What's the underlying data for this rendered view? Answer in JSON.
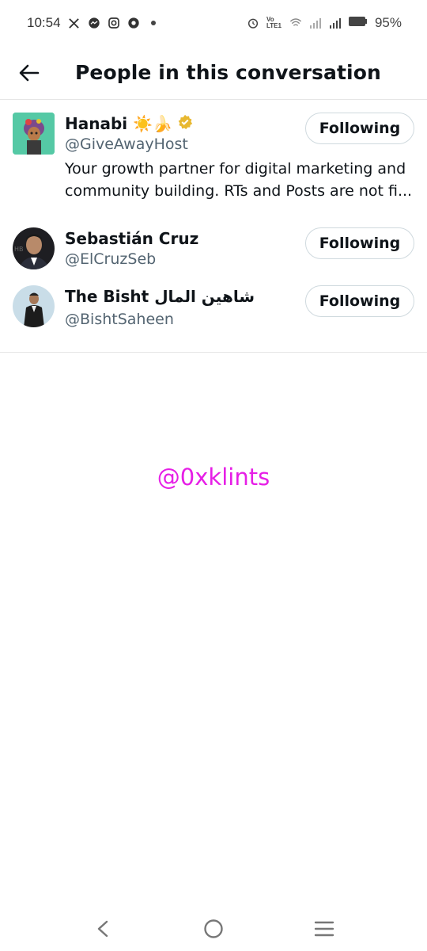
{
  "status_bar": {
    "time": "10:54",
    "battery": "95%",
    "left_icons": [
      "x-logo-icon",
      "messenger-icon",
      "instagram-icon",
      "shutter-icon",
      "dot-icon"
    ],
    "right_icons": [
      "alarm-icon",
      "volte-icon",
      "wifi-icon",
      "signal-icon",
      "signal-icon",
      "battery-icon"
    ],
    "volte_text": "Vo LTE1"
  },
  "header": {
    "title": "People in this conversation",
    "back_icon": "arrow-left-icon"
  },
  "people": [
    {
      "name": "Hanabi ☀️🍌",
      "handle": "@GiveAwayHost",
      "verified": true,
      "bio_line1": "Your growth partner for digital marketing and",
      "bio_line2": "community building. RTs and Posts are not fi...",
      "button": "Following"
    },
    {
      "name": "Sebastián Cruz",
      "handle": "@ElCruzSeb",
      "button": "Following"
    },
    {
      "name": "The Bisht شاهين المال",
      "handle": "@BishtSaheen",
      "button": "Following"
    }
  ],
  "watermark": "@0xklints",
  "nav": [
    "back-nav-icon",
    "home-nav-icon",
    "menu-nav-icon"
  ],
  "colors": {
    "text": "#0f1419",
    "secondary": "#536471",
    "border": "#cfd9de",
    "watermark": "#e61fe6",
    "verified": "#e8b830"
  }
}
